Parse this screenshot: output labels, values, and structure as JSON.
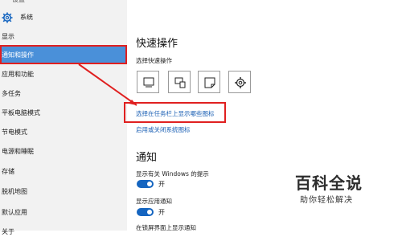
{
  "window": {
    "back_label": "设置",
    "section_title": "系统"
  },
  "sidebar": {
    "items": [
      {
        "label": "显示"
      },
      {
        "label": "通知和操作",
        "selected": true
      },
      {
        "label": "应用和功能"
      },
      {
        "label": "多任务"
      },
      {
        "label": "平板电脑模式"
      },
      {
        "label": "节电模式"
      },
      {
        "label": "电源和睡眠"
      },
      {
        "label": "存储"
      },
      {
        "label": "脱机地图"
      },
      {
        "label": "默认应用"
      },
      {
        "label": "关于"
      }
    ]
  },
  "main": {
    "quick_actions": {
      "title": "快速操作",
      "subtitle": "选择快速操作",
      "tiles": [
        "tablet-mode-icon",
        "connect-icon",
        "note-icon",
        "settings-icon"
      ],
      "link_taskbar_icons": "选择在任务栏上显示哪些图标",
      "link_system_icons": "启用或关闭系统图标"
    },
    "notifications": {
      "title": "通知",
      "tips_label": "显示有关 Windows 的提示",
      "tips_state": "开",
      "app_notif_label": "显示应用通知",
      "app_notif_state": "开",
      "lockscreen_label": "在锁屏界面上显示通知"
    }
  },
  "watermark": {
    "brand": "百科全说",
    "tagline": "助你轻松解决"
  },
  "colors": {
    "accent": "#4a90d9",
    "toggle_on": "#1565c0",
    "highlight_red": "#e02020",
    "link": "#1a5fb4"
  }
}
